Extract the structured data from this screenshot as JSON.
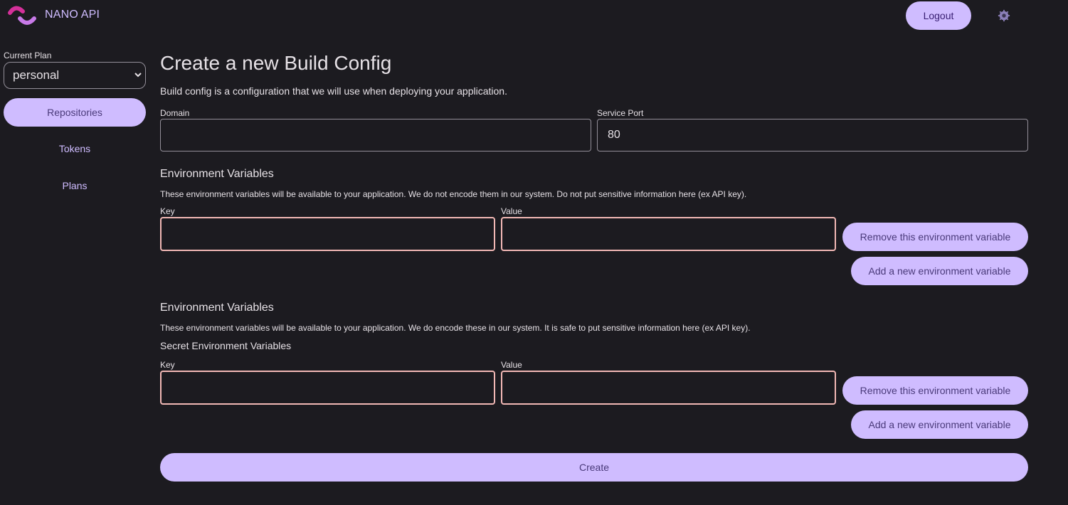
{
  "header": {
    "brand": "NANO API",
    "logo_icon": "nano-api-logo",
    "logout_label": "Logout",
    "settings_icon": "gear-icon"
  },
  "sidebar": {
    "plan_label": "Current Plan",
    "plan_selected": "personal",
    "items": [
      {
        "label": "Repositories",
        "active": true
      },
      {
        "label": "Tokens",
        "active": false
      },
      {
        "label": "Plans",
        "active": false
      }
    ]
  },
  "main": {
    "title": "Create a new Build Config",
    "subtitle": "Build config is a configuration that we will use when deploying your application.",
    "domain": {
      "label": "Domain",
      "value": ""
    },
    "service_port": {
      "label": "Service Port",
      "value": "80"
    },
    "env": {
      "heading": "Environment Variables",
      "description": "These environment variables will be available to your application. We do not encode them in our system. Do not put sensitive information here (ex API key).",
      "key_label": "Key",
      "key_value": "",
      "value_label": "Value",
      "value_value": "",
      "remove_label": "Remove this environment variable",
      "add_label": "Add a new environment variable"
    },
    "secret_env": {
      "heading": "Environment Variables",
      "description": "These environment variables will be available to your application. We do encode these in our system. It is safe to put sensitive information here (ex API key).",
      "subheading": "Secret Environment Variables",
      "key_label": "Key",
      "key_value": "",
      "value_label": "Value",
      "value_value": "",
      "remove_label": "Remove this environment variable",
      "add_label": "Add a new environment variable"
    },
    "create_label": "Create"
  },
  "colors": {
    "background": "#1c1b20",
    "accent": "#cfbcff",
    "accent_text": "#4a3a7a",
    "error_outline": "#f2b8b5",
    "outline": "#938f99"
  }
}
